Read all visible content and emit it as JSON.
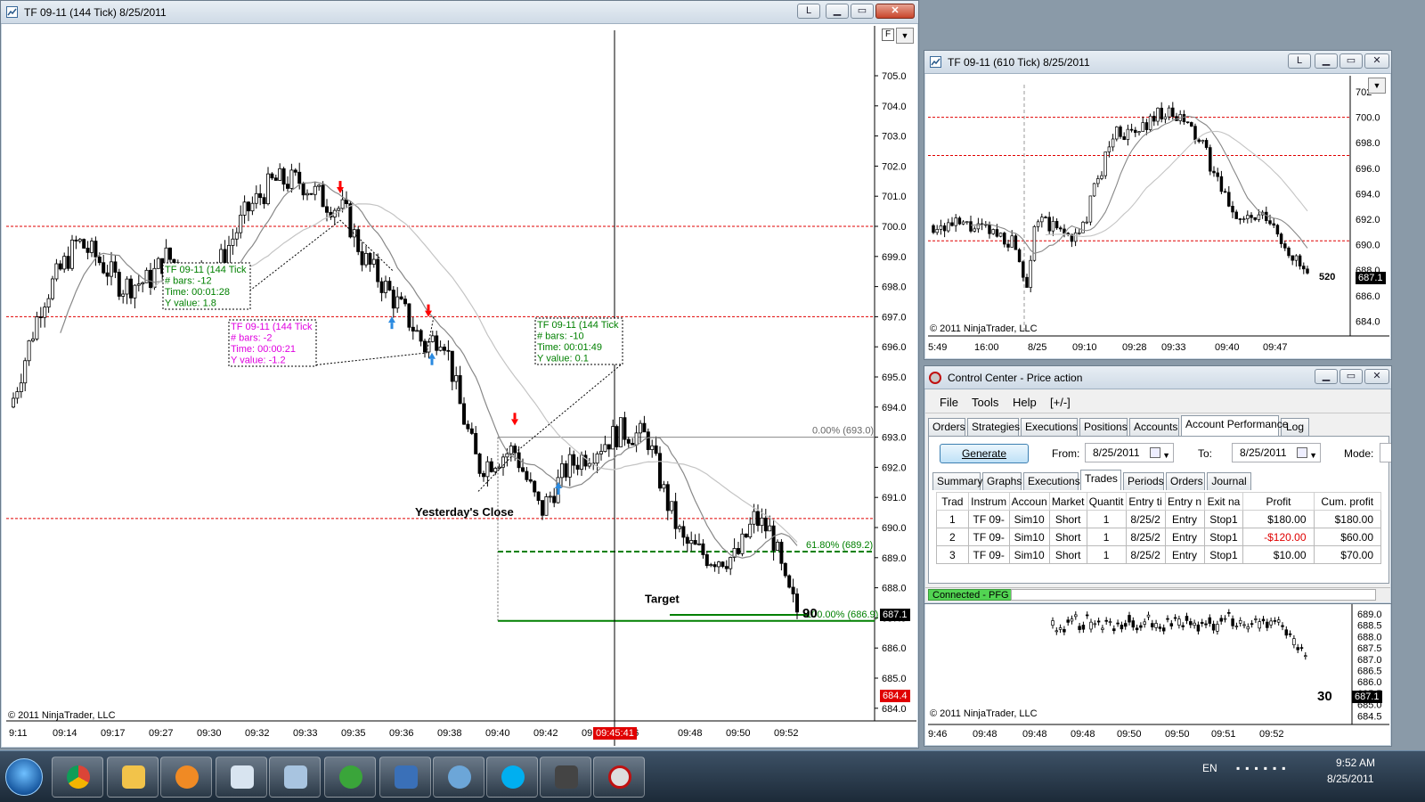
{
  "main_chart": {
    "title": "TF 09-11 (144 Tick)  8/25/2011",
    "btn_l": "L",
    "btn_f": "F",
    "price_labels": [
      "705.0",
      "704.0",
      "703.0",
      "702.0",
      "701.0",
      "700.0",
      "699.0",
      "698.0",
      "697.0",
      "696.0",
      "695.0",
      "694.0",
      "693.0",
      "692.0",
      "691.0",
      "690.0",
      "689.0",
      "688.0",
      "687.0",
      "686.0",
      "685.0",
      "684.0"
    ],
    "time_labels": [
      "9:11",
      "09:14",
      "09:17",
      "09:27",
      "09:30",
      "09:32",
      "09:33",
      "09:35",
      "09:36",
      "09:38",
      "09:40",
      "09:42",
      "09:",
      "46",
      "09:48",
      "09:50",
      "09:52"
    ],
    "crosshair_time": "09:45:41",
    "last_price": "687.1",
    "crosshair_price": "684.4",
    "count": "90",
    "copyright": "© 2011 NinjaTrader, LLC",
    "yesterdays_close": "Yesterday's Close",
    "target": "Target",
    "fib_0": "0.00% (693.0)",
    "fib_618": "61.80% (689.2)",
    "fib_100": "100.00% (686.9)",
    "box1": {
      "l1": "TF 09-11 (144 Tick",
      "l2": "# bars:   -12",
      "l3": "Time:     00:01:28",
      "l4": "Y value: 1.8"
    },
    "box2": {
      "l1": "TF 09-11 (144 Tick",
      "l2": "# bars:    -2",
      "l3": "Time:     00:00:21",
      "l4": "Y value: -1.2"
    },
    "box3": {
      "l1": "TF 09-11 (144 Tick",
      "l2": "# bars:   -10",
      "l3": "Time:     00:01:49",
      "l4": "Y value: 0.1"
    },
    "colors": {
      "bull": "#ffffff",
      "bear": "#000000",
      "red_line": "#e00000",
      "green": "#008000",
      "ma": "#999999"
    }
  },
  "chart610": {
    "title": "TF 09-11 (610 Tick)  8/25/2011",
    "btn_l": "L",
    "price_labels": [
      "702",
      "700.0",
      "698.0",
      "696.0",
      "694.0",
      "692.0",
      "690.0",
      "688.0",
      "686.0",
      "684.0"
    ],
    "time_labels": [
      "5:49",
      "16:00",
      "8/25",
      "09:10",
      "09:28",
      "09:33",
      "09:40",
      "09:47"
    ],
    "last_price": "687.1",
    "count": "520",
    "copyright": "© 2011 NinjaTrader, LLC"
  },
  "chart_back": {
    "price_labels": [
      "689.0",
      "688.5",
      "688.0",
      "687.5",
      "687.0",
      "686.5",
      "686.0",
      "685.5",
      "685.0",
      "684.5",
      "684.0"
    ],
    "time_labels": [
      "9:46",
      "09:48",
      "09:48",
      "09:48",
      "09:50",
      "09:50",
      "09:51",
      "09:52"
    ],
    "last_price": "687.1",
    "count": "30",
    "copyright": "© 2011 NinjaTrader, LLC"
  },
  "control_center": {
    "title": "Control Center - Price action",
    "menu": [
      "File",
      "Tools",
      "Help",
      "[+/-]"
    ],
    "tabs": [
      "Orders",
      "Strategies",
      "Executions",
      "Positions",
      "Accounts",
      "Account Performance",
      "Log"
    ],
    "generate": "Generate",
    "from_label": "From:",
    "from_value": "8/25/2011",
    "to_label": "To:",
    "to_value": "8/25/2011",
    "mode_label": "Mode:",
    "subtabs": [
      "Summary",
      "Graphs",
      "Executions",
      "Trades",
      "Periods",
      "Orders",
      "Journal"
    ],
    "columns": [
      "Trad",
      "Instrum",
      "Accoun",
      "Market",
      "Quantit",
      "Entry ti",
      "Entry n",
      "Exit na",
      "Profit",
      "Cum. profit"
    ],
    "rows": [
      [
        "1",
        "TF 09-",
        "Sim10",
        "Short",
        "1",
        "8/25/2",
        "Entry",
        "Stop1",
        "$180.00",
        "$180.00"
      ],
      [
        "2",
        "TF 09-",
        "Sim10",
        "Short",
        "1",
        "8/25/2",
        "Entry",
        "Stop1",
        "-$120.00",
        "$60.00"
      ],
      [
        "3",
        "TF 09-",
        "Sim10",
        "Short",
        "1",
        "8/25/2",
        "Entry",
        "Stop1",
        "$10.00",
        "$70.00"
      ]
    ],
    "status": "Connected - PFG"
  },
  "taskbar": {
    "lang": "EN",
    "time": "9:52 AM",
    "date": "8/25/2011",
    "apps": [
      "chrome-icon",
      "explorer-icon",
      "media-player-icon",
      "calendar-icon",
      "calculator-icon",
      "utorrent-icon",
      "notebook-icon",
      "gtalk-icon",
      "skype-icon",
      "camera-icon",
      "ninjatrader-icon"
    ]
  }
}
